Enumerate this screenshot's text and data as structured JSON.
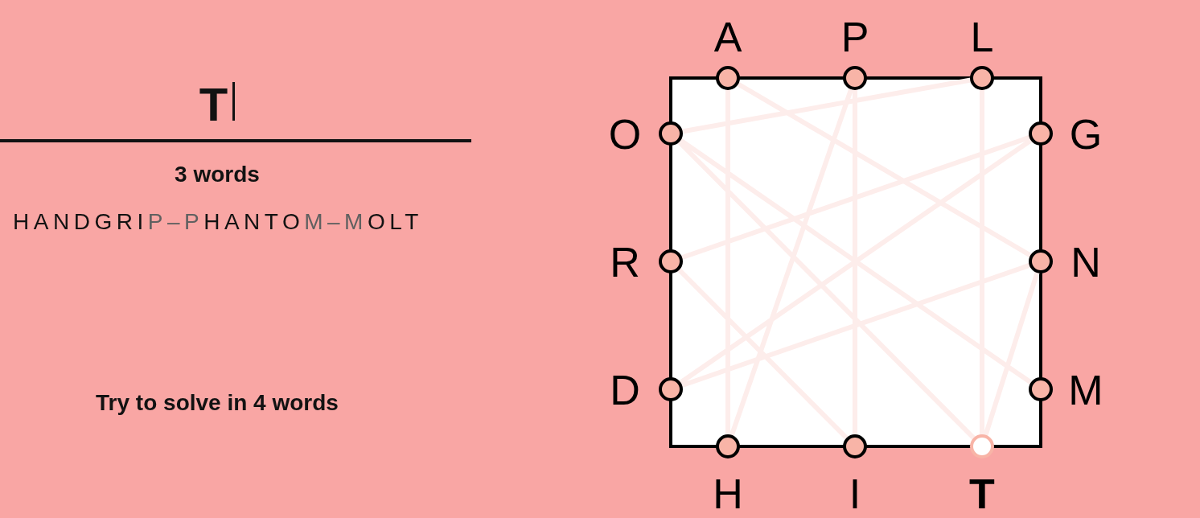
{
  "entry": {
    "value": "T"
  },
  "word_count": "3 words",
  "found_words": {
    "words": [
      "HANDGRIP",
      "PHANTOM",
      "MOLT"
    ],
    "separator": "–"
  },
  "goal": "Try to solve in 4 words",
  "board": {
    "sides": [
      {
        "kind": "top",
        "letters": [
          {
            "letter": "A",
            "used": true,
            "current": false
          },
          {
            "letter": "P",
            "used": true,
            "current": false
          },
          {
            "letter": "L",
            "used": true,
            "current": false
          }
        ]
      },
      {
        "kind": "left",
        "letters": [
          {
            "letter": "O",
            "used": true,
            "current": false
          },
          {
            "letter": "R",
            "used": true,
            "current": false
          },
          {
            "letter": "D",
            "used": true,
            "current": false
          }
        ]
      },
      {
        "kind": "right",
        "letters": [
          {
            "letter": "G",
            "used": true,
            "current": false
          },
          {
            "letter": "N",
            "used": true,
            "current": false
          },
          {
            "letter": "M",
            "used": true,
            "current": false
          }
        ]
      },
      {
        "kind": "bottom",
        "letters": [
          {
            "letter": "H",
            "used": true,
            "current": false
          },
          {
            "letter": "I",
            "used": true,
            "current": false
          },
          {
            "letter": "T",
            "used": true,
            "current": true
          }
        ]
      }
    ]
  }
}
